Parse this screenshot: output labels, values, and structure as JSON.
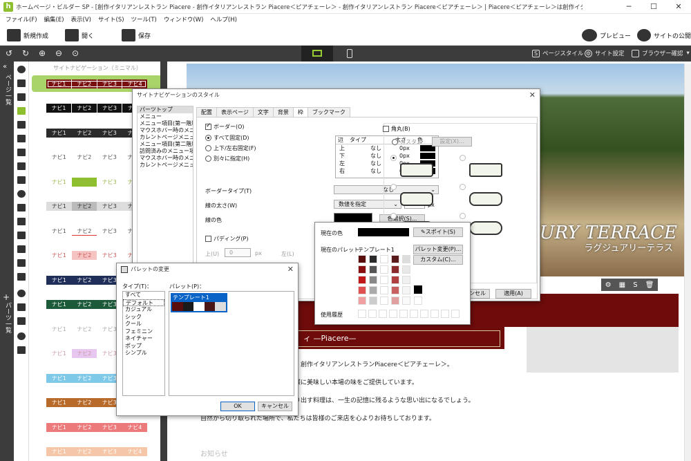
{
  "window": {
    "title": "ホームページ・ビルダー SP - [創作イタリアンレストラン Piacere - 創作イタリアンレストラン Piacere＜ピアチェーレ＞ - 創作イタリアンレストラン Piacere＜ピアチェーレ＞ | Piacere＜ピアチェーレ＞は創作イタリアンレストランです。*]",
    "app_icon": "h",
    "minimize": "─",
    "maximize": "☐",
    "close": "✕"
  },
  "menu": [
    "ファイル(F)",
    "編集(E)",
    "表示(V)",
    "サイト(S)",
    "ツール(T)",
    "ウィンドウ(W)",
    "ヘルプ(H)"
  ],
  "toolbar": {
    "new": "新規作成",
    "open": "開く",
    "save": "保存",
    "preview": "プレビュー",
    "publish": "サイトの公開"
  },
  "darkbar": {
    "page_style": "ページスタイル",
    "site_settings": "サイト設定",
    "browser_check": "ブラウザー確認"
  },
  "rail": {
    "page_list": "ページ一覧",
    "parts_list": "パーツ一覧"
  },
  "nav_panel": {
    "header": "サイトナビゲーション（ミニマル）",
    "label": "ナビ1",
    "items": [
      "ナビ1",
      "ナビ2",
      "ナビ3",
      "ナビ4"
    ],
    "rows": [
      {
        "bg": "#7a0f0f",
        "fg": "#fff",
        "sep": true,
        "active_bg": "",
        "outline": true
      },
      {
        "bg": "#111111",
        "fg": "#fff",
        "sep": true
      },
      {
        "bg": "#2b2b2b",
        "fg": "#eee",
        "sep": false
      },
      {
        "bg": "#ffffff",
        "fg": "#555",
        "sep": false
      },
      {
        "bg": "#ffffff",
        "fg": "#9ab84a",
        "sep": false,
        "active_bg": "#8dbf2f"
      },
      {
        "bg": "#dddddd",
        "fg": "#333",
        "sep": false,
        "active_bg": "#bbbbbb"
      },
      {
        "bg": "#ffffff",
        "fg": "#555",
        "sep": false,
        "underline": "#d33"
      },
      {
        "bg": "#ffffff",
        "fg": "#c55",
        "sep": false,
        "active_bg": "#f6c3c3"
      },
      {
        "bg": "#1f2f5a",
        "fg": "#fff",
        "sep": false
      },
      {
        "bg": "#1d5a3a",
        "fg": "#fff",
        "sep": false
      },
      {
        "bg": "#ffffff",
        "fg": "#aaa",
        "sep": false
      },
      {
        "bg": "#ffffff",
        "fg": "#c9a",
        "sep": false,
        "active_bg": "#e7c7ef"
      },
      {
        "bg": "#7ec8e8",
        "fg": "#fff",
        "sep": false
      },
      {
        "bg": "#b86a2a",
        "fg": "#fff",
        "sep": false
      },
      {
        "bg": "#ec7a7a",
        "fg": "#fff",
        "sep": false
      },
      {
        "bg": "#f5c7a8",
        "fg": "#fff",
        "sep": false
      }
    ]
  },
  "hero": {
    "title": "XURY TERRACE",
    "subtitle": "ラグジュアリーテラス"
  },
  "content": {
    "heading": "ィ —Piacere—",
    "para1": "、創作イタリアンレストランPiacere＜ピアチェーレ＞。",
    "para2": "様に美味しい本場の味をご提供しています。",
    "para3": "り出す料理は、一生の記憶に残るような思い出になるでしょう。",
    "para4": "自然から切り取られた場所で、私たちは皆様のご来店を心よりお待ちしております。",
    "news": "お知らせ"
  },
  "style_dialog": {
    "title": "サイトナビゲーションのスタイル",
    "tree": [
      "パーツトップ",
      "メニュー",
      "メニュー項目(第一階層)",
      "マウスホバー時のメニュー項目",
      "カレントページメニュー項目",
      "メニュー項目(第二階層)",
      "訪問済みのメニュー項目",
      "マウスホバー時のメニュー",
      "カレントページメニュー項目"
    ],
    "tabs": [
      "配置",
      "表示ページ",
      "文字",
      "背景",
      "枠",
      "ブックマーク"
    ],
    "active_tab": "枠",
    "border_check": "ボーダー(O)",
    "radio_all": "すべて固定(D)",
    "radio_tb": "上下/左右固定(F)",
    "radio_each": "別々に指定(H)",
    "table_head": [
      "辺",
      "タイプ",
      "太さ",
      "色"
    ],
    "table_rows": [
      [
        "上",
        "なし",
        "0px"
      ],
      [
        "下",
        "なし",
        "0px"
      ],
      [
        "左",
        "なし",
        "0px"
      ],
      [
        "右",
        "なし",
        "0px"
      ]
    ],
    "border_type_label": "ボーダータイプ(T)",
    "border_type_value": "なし",
    "width_label": "線の太さ(W)",
    "width_value": "数値を指定",
    "width_num": "0",
    "width_unit": "px",
    "color_label": "線の色",
    "color_btn": "色選択(S)...",
    "padding_check": "パディング(P)",
    "pad_top": "上(U)",
    "pad_left": "左(L)",
    "pad_val": "0",
    "pad_unit": "px",
    "corner_check": "角丸(B)",
    "custom": "カスタム",
    "settings_btn": "設定(X)...",
    "cancel": "キャンセル",
    "apply": "適用(A)"
  },
  "color_popup": {
    "current_color": "現在の色",
    "eyedropper": "スポイト(S)",
    "current_palette": "現在のパレット",
    "palette_name": "テンプレート1",
    "change_palette": "パレット変更(P)...",
    "custom": "カスタム(C)...",
    "history": "使用履歴",
    "swatches": [
      [
        "#5a0d0d",
        "#2a2a2a",
        "#ffffff",
        "#5a1a1a",
        "#dddddd"
      ],
      [
        "#8a1010",
        "#555555",
        "#ffffff",
        "#8a2a2a",
        "#e8e8e8"
      ],
      [
        "#c01818",
        "#888888",
        "#ffffff",
        "#b04040",
        "#f0f0f0"
      ],
      [
        "#e05050",
        "#aaaaaa",
        "#ffffff",
        "#c86060",
        "#f5f5f5"
      ],
      [
        "#f0a0a0",
        "#cccccc",
        "#ffffff",
        "#e0a0a0",
        "#fafafa"
      ]
    ],
    "current_hex": "#000000"
  },
  "palette_dialog": {
    "title": "パレットの変更",
    "type_label": "タイプ(T)：",
    "palette_label": "パレット(P)：",
    "types": [
      "すべて",
      "デフォルト",
      "カジュアル",
      "シック",
      "クール",
      "フェミニン",
      "ネイチャー",
      "ポップ",
      "シンプル"
    ],
    "selected_type": "デフォルト",
    "palette_item": "テンプレート1",
    "palette_colors": [
      "#5a0d0d",
      "#1a1a1a",
      "#ffffff",
      "#4a1515",
      "#dddddd"
    ],
    "ok": "OK",
    "cancel": "キャンセル"
  },
  "colors": {
    "accent_green": "#8dbf2f",
    "dark": "#3c3c3c",
    "brand_red": "#6e0b0b",
    "selection_blue": "#0a64c8"
  }
}
